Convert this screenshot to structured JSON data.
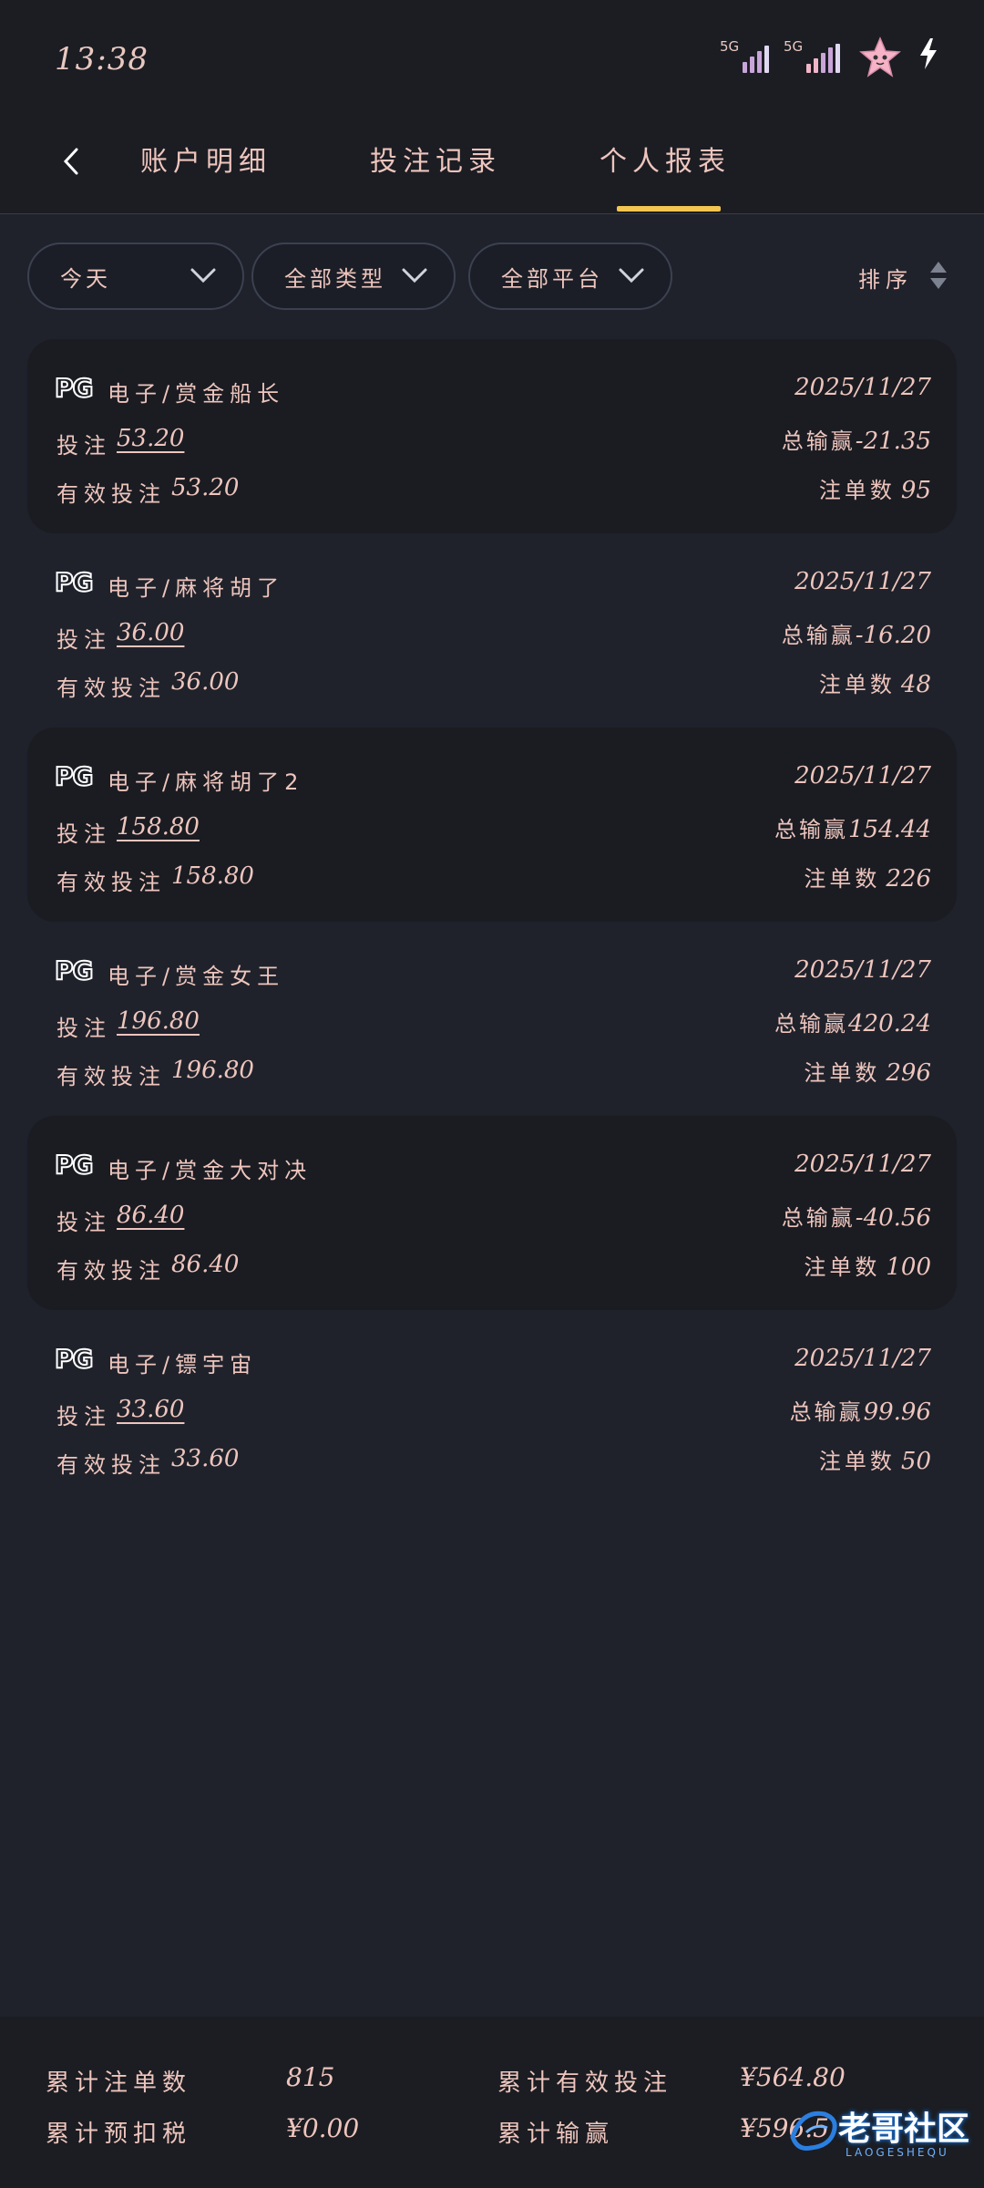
{
  "status": {
    "time": "13:38",
    "signal1_label": "5G",
    "signal2_label": "5G",
    "icons": [
      "signal-icon",
      "signal-icon",
      "star-avatar-icon",
      "charging-icon"
    ]
  },
  "nav": {
    "tabs": [
      {
        "label": "账户明细"
      },
      {
        "label": "投注记录"
      },
      {
        "label": "个人报表"
      }
    ],
    "active_tab": "个人报表"
  },
  "filters": {
    "time": "今天",
    "type": "全部类型",
    "platform": "全部平台",
    "sort_label": "排序"
  },
  "records": [
    {
      "logo": "PG",
      "game": "电子/赏金船长",
      "date": "2025/11/27",
      "bet_label": "投注",
      "bet": "53.20",
      "valid_label": "有效投注",
      "valid": "53.20",
      "winloss_label": "总输赢",
      "winloss": "-21.35",
      "orders_label": "注单数",
      "orders": "95"
    },
    {
      "logo": "PG",
      "game": "电子/麻将胡了",
      "date": "2025/11/27",
      "bet_label": "投注",
      "bet": "36.00",
      "valid_label": "有效投注",
      "valid": "36.00",
      "winloss_label": "总输赢",
      "winloss": "-16.20",
      "orders_label": "注单数",
      "orders": "48"
    },
    {
      "logo": "PG",
      "game": "电子/麻将胡了2",
      "date": "2025/11/27",
      "bet_label": "投注",
      "bet": "158.80",
      "valid_label": "有效投注",
      "valid": "158.80",
      "winloss_label": "总输赢",
      "winloss": "154.44",
      "orders_label": "注单数",
      "orders": "226"
    },
    {
      "logo": "PG",
      "game": "电子/赏金女王",
      "date": "2025/11/27",
      "bet_label": "投注",
      "bet": "196.80",
      "valid_label": "有效投注",
      "valid": "196.80",
      "winloss_label": "总输赢",
      "winloss": "420.24",
      "orders_label": "注单数",
      "orders": "296"
    },
    {
      "logo": "PG",
      "game": "电子/赏金大对决",
      "date": "2025/11/27",
      "bet_label": "投注",
      "bet": "86.40",
      "valid_label": "有效投注",
      "valid": "86.40",
      "winloss_label": "总输赢",
      "winloss": "-40.56",
      "orders_label": "注单数",
      "orders": "100"
    },
    {
      "logo": "PG",
      "game": "电子/镖宇宙",
      "date": "2025/11/27",
      "bet_label": "投注",
      "bet": "33.60",
      "valid_label": "有效投注",
      "valid": "33.60",
      "winloss_label": "总输赢",
      "winloss": "99.96",
      "orders_label": "注单数",
      "orders": "50"
    }
  ],
  "summary": {
    "total_orders_label": "累计注单数",
    "total_orders": "815",
    "total_valid_label": "累计有效投注",
    "total_valid": "¥564.80",
    "tax_label": "累计预扣税",
    "tax": "¥0.00",
    "total_winloss_label": "累计输赢",
    "total_winloss": "¥596.5"
  },
  "watermark": {
    "text": "老哥社区",
    "sub": "LAOGESHEQU"
  },
  "colors": {
    "background": "#1f222b",
    "accent_tab": "#f3c651",
    "text": "#eec5bd"
  }
}
